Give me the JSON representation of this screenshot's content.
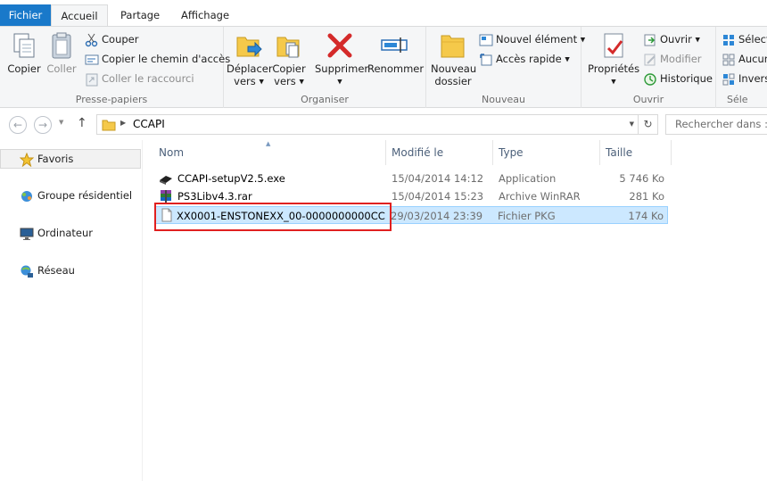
{
  "tabs": {
    "file": "Fichier",
    "home": "Accueil",
    "share": "Partage",
    "view": "Affichage"
  },
  "ribbon": {
    "clipboard": {
      "label": "Presse-papiers",
      "copy": "Copier",
      "paste": "Coller",
      "cut": "Couper",
      "copy_path": "Copier le chemin d'accès",
      "paste_shortcut": "Coller le raccourci"
    },
    "organize": {
      "label": "Organiser",
      "move_to_1": "Déplacer",
      "move_to_2": "vers",
      "copy_to_1": "Copier",
      "copy_to_2": "vers",
      "delete": "Supprimer",
      "rename": "Renommer"
    },
    "new": {
      "label": "Nouveau",
      "new_folder_1": "Nouveau",
      "new_folder_2": "dossier",
      "new_item": "Nouvel élément",
      "easy_access": "Accès rapide"
    },
    "open": {
      "label": "Ouvrir",
      "properties": "Propriétés",
      "open": "Ouvrir",
      "edit": "Modifier",
      "history": "Historique"
    },
    "select": {
      "label": "Séle",
      "select_all": "Sélect",
      "select_none": "Aucun",
      "invert": "Invers"
    }
  },
  "address": {
    "crumb": "CCAPI",
    "search_placeholder": "Rechercher dans : C"
  },
  "nav": {
    "favorites": "Favoris",
    "homegroup": "Groupe résidentiel",
    "computer": "Ordinateur",
    "network": "Réseau"
  },
  "columns": {
    "name": "Nom",
    "date": "Modifié le",
    "type": "Type",
    "size": "Taille"
  },
  "files": [
    {
      "name": "CCAPI-setupV2.5.exe",
      "date": "15/04/2014 14:12",
      "type": "Application",
      "size": "5 746 Ko",
      "icon": "exe-icon"
    },
    {
      "name": "PS3Libv4.3.rar",
      "date": "15/04/2014 15:23",
      "type": "Archive WinRAR",
      "size": "281 Ko",
      "icon": "winrar-icon"
    },
    {
      "name": "XX0001-ENSTONEXX_00-0000000000CC...",
      "date": "29/03/2014 23:39",
      "type": "Fichier PKG",
      "size": "174 Ko",
      "icon": "file-icon",
      "selected": true
    }
  ],
  "colors": {
    "accent": "#1979ca",
    "selection": "#cce8ff",
    "highlight_box": "#e02020"
  }
}
